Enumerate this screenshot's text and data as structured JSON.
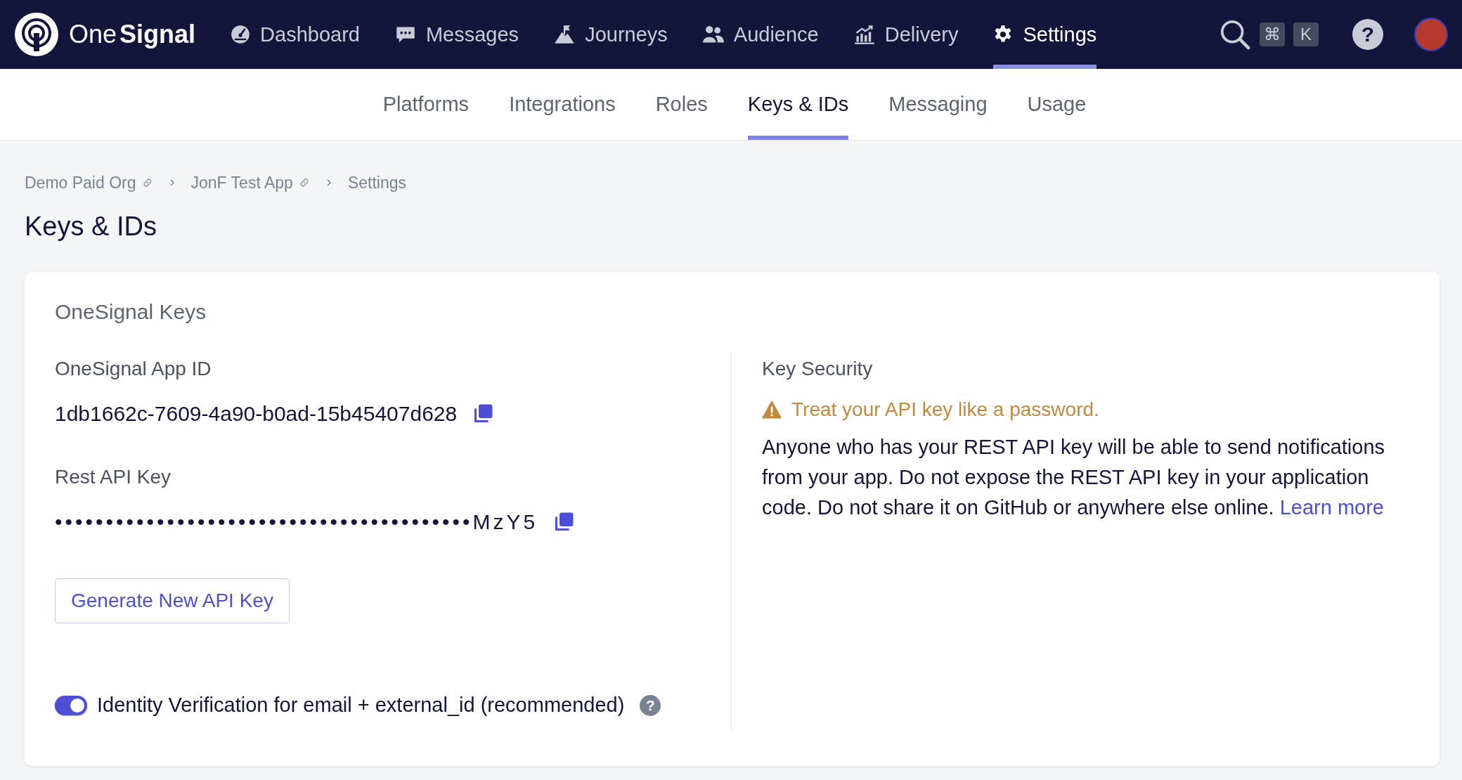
{
  "nav": {
    "logo": {
      "light": "One",
      "bold": "Signal"
    },
    "items": [
      {
        "label": "Dashboard",
        "selected": false
      },
      {
        "label": "Messages",
        "selected": false
      },
      {
        "label": "Journeys",
        "selected": false
      },
      {
        "label": "Audience",
        "selected": false
      },
      {
        "label": "Delivery",
        "selected": false
      },
      {
        "label": "Settings",
        "selected": true
      }
    ],
    "shortcut_keys": [
      "⌘",
      "K"
    ],
    "help": "?"
  },
  "subnav": {
    "tabs": [
      {
        "label": "Platforms",
        "selected": false
      },
      {
        "label": "Integrations",
        "selected": false
      },
      {
        "label": "Roles",
        "selected": false
      },
      {
        "label": "Keys & IDs",
        "selected": true
      },
      {
        "label": "Messaging",
        "selected": false
      },
      {
        "label": "Usage",
        "selected": false
      }
    ]
  },
  "breadcrumb": [
    {
      "label": "Demo Paid Org",
      "link": true
    },
    {
      "label": "JonF Test App",
      "link": true
    },
    {
      "label": "Settings",
      "link": false
    }
  ],
  "page_title": "Keys & IDs",
  "card": {
    "title": "OneSignal Keys",
    "fields": [
      {
        "label": "OneSignal App ID",
        "value": "1db1662c-7609-4a90-b0ad-15b45407d628"
      },
      {
        "label": "Rest API Key",
        "value": "•••••••••••••••••••••••••••••••••••••••••MzY5"
      }
    ],
    "generate_button": "Generate New API Key",
    "toggle": {
      "label": "Identity Verification for email + external_id (recommended)",
      "on": true,
      "help": "?"
    },
    "security": {
      "title": "Key Security",
      "warning": "Treat your API key like a password.",
      "body": "Anyone who has your REST API key will be able to send notifications from your app. Do not expose the REST API key in your application code. Do not share it on GitHub or anywhere else online.",
      "link": "Learn more"
    }
  }
}
